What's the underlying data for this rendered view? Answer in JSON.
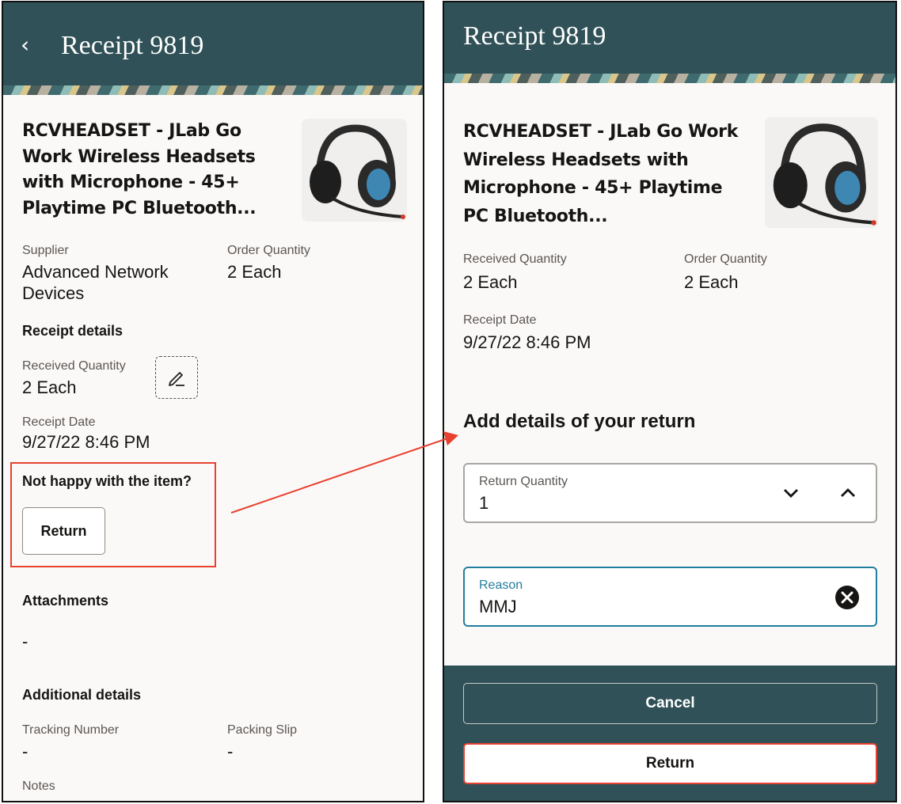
{
  "left": {
    "title": "Receipt 9819",
    "product_name": "RCVHEADSET - JLab Go Work Wireless Headsets with Microphone - 45+ Playtime PC Bluetooth...",
    "supplier_label": "Supplier",
    "supplier_value": "Advanced Network Devices",
    "order_qty_label": "Order Quantity",
    "order_qty_value": "2 Each",
    "receipt_details_heading": "Receipt details",
    "received_qty_label": "Received Quantity",
    "received_qty_value": "2 Each",
    "receipt_date_label": "Receipt Date",
    "receipt_date_value": "9/27/22 8:46 PM",
    "not_happy_text": "Not happy with the item?",
    "return_button": "Return",
    "attachments_heading": "Attachments",
    "attachments_value": "-",
    "additional_heading": "Additional details",
    "tracking_label": "Tracking Number",
    "tracking_value": "-",
    "packing_label": "Packing Slip",
    "packing_value": "-",
    "notes_label": "Notes"
  },
  "right": {
    "title": "Receipt 9819",
    "product_name": "RCVHEADSET - JLab Go Work Wireless Headsets with Microphone - 45+ Playtime PC Bluetooth...",
    "received_qty_label": "Received Quantity",
    "received_qty_value": "2 Each",
    "order_qty_label": "Order Quantity",
    "order_qty_value": "2 Each",
    "receipt_date_label": "Receipt Date",
    "receipt_date_value": "9/27/22 8:46 PM",
    "return_heading": "Add details of your return",
    "return_qty_label": "Return Quantity",
    "return_qty_value": "1",
    "reason_label": "Reason",
    "reason_value": "MMJ",
    "cancel_button": "Cancel",
    "return_button": "Return"
  },
  "colors": {
    "header": "#2f5157",
    "highlight": "#e8412f",
    "reason_accent": "#227e9e"
  },
  "icons": [
    "back-icon",
    "edit-icon",
    "chevron-down-icon",
    "chevron-up-icon",
    "clear-icon",
    "headset-image"
  ]
}
